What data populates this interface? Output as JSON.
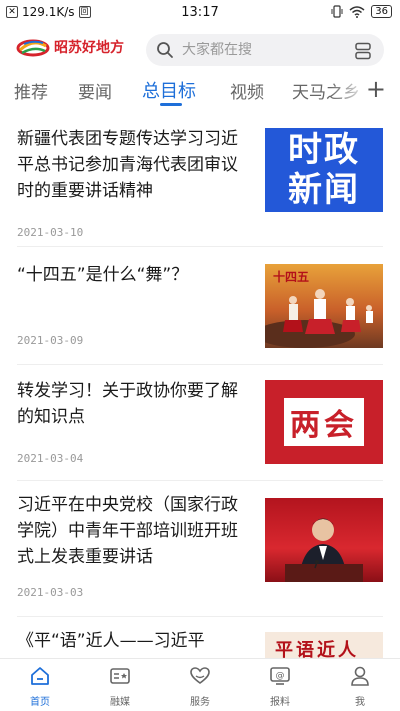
{
  "status_bar": {
    "speed": "129.1K/s",
    "time": "13:17",
    "battery": "36"
  },
  "header": {
    "logo_text": "昭苏好地方",
    "search_placeholder": "大家都在搜"
  },
  "tabs": [
    {
      "label": "推荐"
    },
    {
      "label": "要闻"
    },
    {
      "label": "总目标"
    },
    {
      "label": "视频"
    },
    {
      "label": "天马之乡"
    }
  ],
  "active_tab": "总目标",
  "articles": [
    {
      "title": "新疆代表团专题传达学习习近平总书记参加青海代表团审议时的重要讲话精神",
      "date": "2021-03-10",
      "thumb_text_1": "时政",
      "thumb_text_2": "新闻"
    },
    {
      "title": "“十四五”是什么“舞”？",
      "date": "2021-03-09",
      "thumb_text_1": "十四五"
    },
    {
      "title": "转发学习！关于政协你要了解的知识点",
      "date": "2021-03-04",
      "thumb_text_1": "两会"
    },
    {
      "title": "习近平在中央党校（国家行政学院）中青年干部培训班开班式上发表重要讲话",
      "date": "2021-03-03"
    },
    {
      "title": "《平“语”近人——习近平",
      "thumb_text_1": "平语近人"
    }
  ],
  "bottom_nav": [
    {
      "label": "首页",
      "icon": "home-icon"
    },
    {
      "label": "融媒",
      "icon": "media-icon"
    },
    {
      "label": "服务",
      "icon": "heart-hand-icon"
    },
    {
      "label": "报料",
      "icon": "report-icon"
    },
    {
      "label": "我",
      "icon": "user-icon"
    }
  ],
  "colors": {
    "accent": "#1e6fd9",
    "logo_red": "#d6232c",
    "thumb_blue": "#2358d8",
    "thumb_red": "#c8202a"
  }
}
